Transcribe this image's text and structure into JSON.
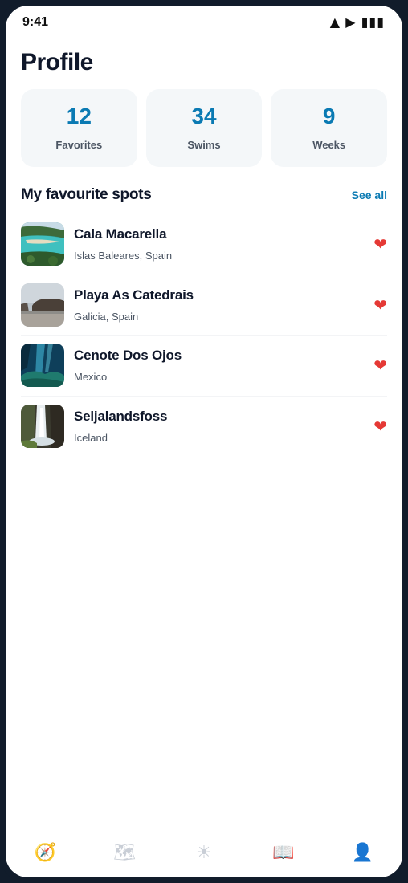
{
  "status_bar": {
    "time": "9:41",
    "icons": "▲ ▶ ▮▮▮"
  },
  "page": {
    "title": "Profile"
  },
  "stats": [
    {
      "value": "12",
      "label": "Favorites"
    },
    {
      "value": "34",
      "label": "Swims"
    },
    {
      "value": "9",
      "label": "Weeks"
    }
  ],
  "favourites": {
    "title": "My favourite spots",
    "see_all": "See all",
    "items": [
      {
        "name": "Cala Macarella",
        "location": "Islas Baleares, Spain",
        "icon": "heart-icon"
      },
      {
        "name": "Playa As Catedrais",
        "location": "Galicia, Spain",
        "icon": "heart-icon"
      },
      {
        "name": "Cenote Dos Ojos",
        "location": "Mexico",
        "icon": "heart-icon"
      },
      {
        "name": "Seljalandsfoss",
        "location": "Iceland",
        "icon": "heart-icon"
      }
    ]
  },
  "tab_bar": {
    "tabs": [
      {
        "icon": "compass-icon",
        "glyph": "🧭"
      },
      {
        "icon": "map-icon",
        "glyph": "🗺"
      },
      {
        "icon": "sun-icon",
        "glyph": "☀"
      },
      {
        "icon": "book-icon",
        "glyph": "📖"
      },
      {
        "icon": "profile-icon",
        "glyph": "👤"
      }
    ],
    "active_index": 4
  },
  "colors": {
    "accent": "#0a7ab3",
    "heart": "#e53935",
    "title": "#0f172a",
    "frame": "#111c2b"
  }
}
